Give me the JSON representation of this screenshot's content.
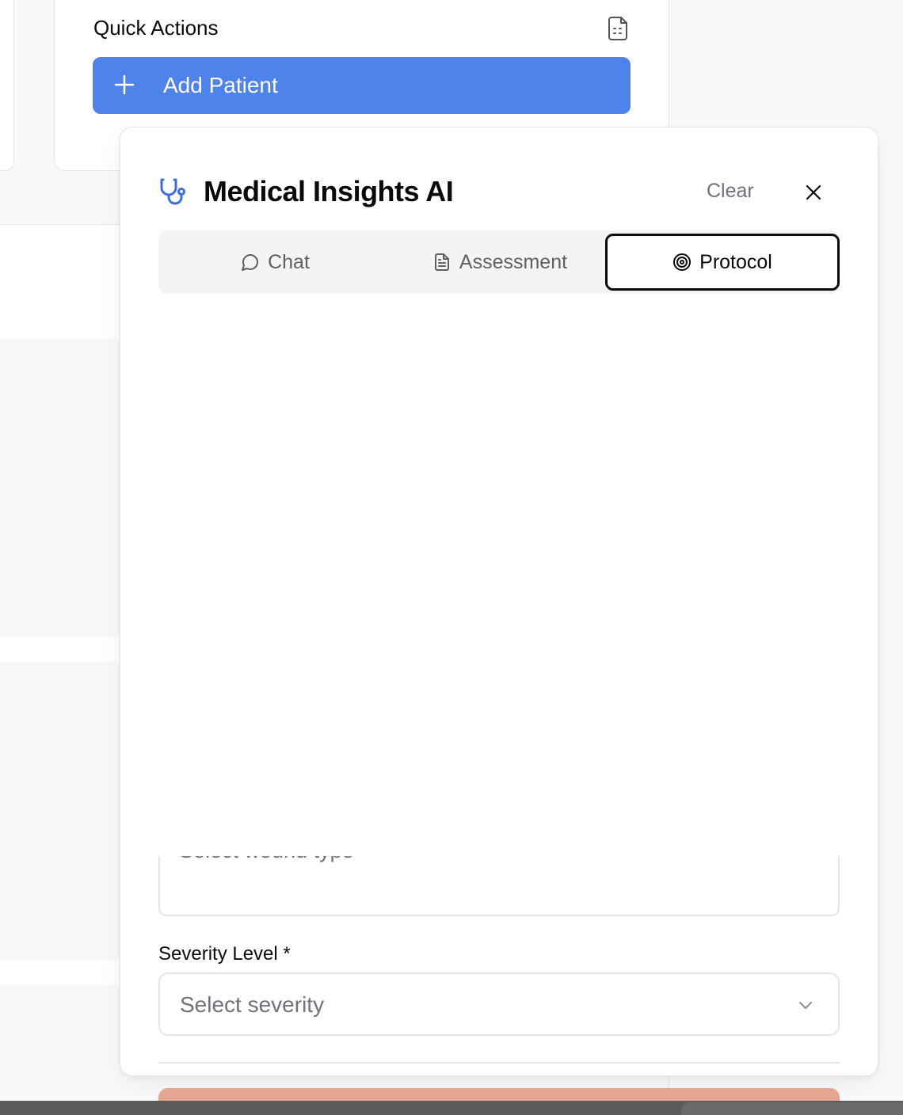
{
  "quick_actions": {
    "title": "Quick Actions",
    "add_patient_label": "Add Patient",
    "accent_color": "#4f83ec"
  },
  "dialog": {
    "title": "Medical Insights AI",
    "clear_label": "Clear",
    "icon": "stethoscope-icon",
    "tabs": [
      {
        "label": "Chat",
        "icon": "message-circle-icon",
        "active": false
      },
      {
        "label": "Assessment",
        "icon": "file-text-icon",
        "active": false
      },
      {
        "label": "Protocol",
        "icon": "target-icon",
        "active": true
      }
    ],
    "wound_type": {
      "placeholder": "Select wound type"
    },
    "severity": {
      "label": "Severity Level *",
      "placeholder": "Select severity"
    }
  }
}
